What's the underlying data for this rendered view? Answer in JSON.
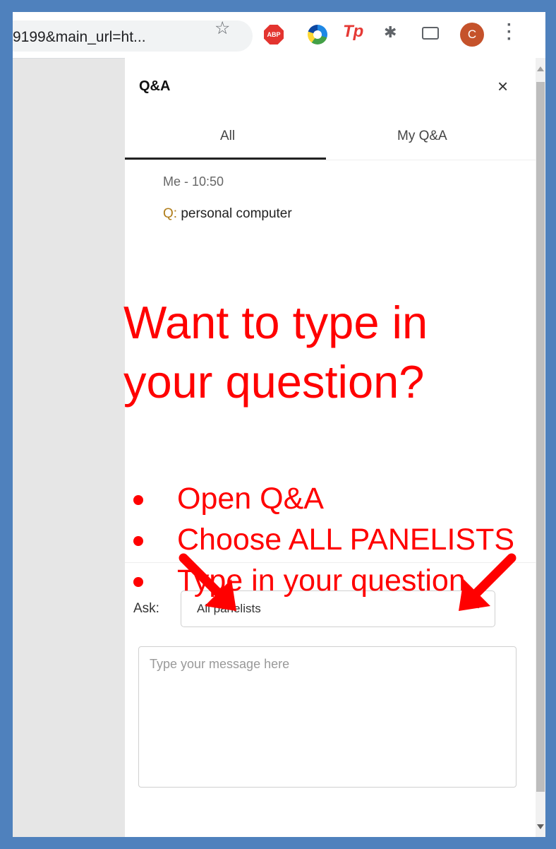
{
  "browser": {
    "url": "9199&main_url=ht...",
    "star_icon": "star-icon",
    "extensions": {
      "abp_label": "ABP",
      "tp_label": "Tp"
    },
    "avatar_initial": "C"
  },
  "panel": {
    "title": "Q&A",
    "close": "×",
    "tabs": [
      {
        "label": "All",
        "active": true
      },
      {
        "label": "My Q&A",
        "active": false
      }
    ],
    "message": {
      "meta": "Me - 10:50",
      "prefix": "Q:",
      "text": " personal computer"
    },
    "ask": {
      "label": "Ask:",
      "selected": "All panelists",
      "placeholder": "Type your message here"
    }
  },
  "overlay": {
    "headline_line1": "Want to type in",
    "headline_line2": "your question?",
    "bullets": [
      "Open Q&A",
      "Choose ALL PANELISTS",
      "Type in your question"
    ],
    "color": "#ff0000"
  }
}
